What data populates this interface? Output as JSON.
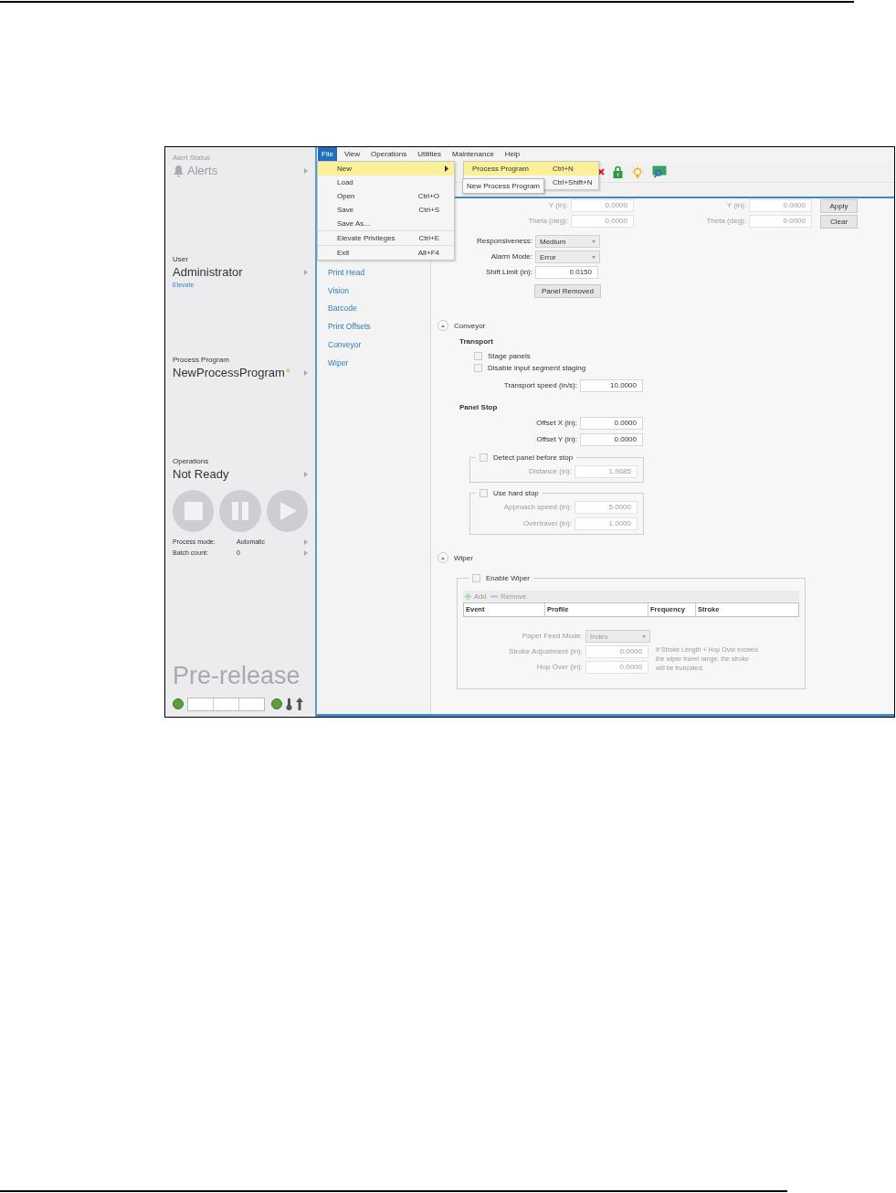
{
  "sidebar": {
    "alert_status": {
      "label": "Alert Status",
      "value": "Alerts",
      "disabled": true
    },
    "user": {
      "label": "User",
      "value": "Administrator",
      "link": "Elevate"
    },
    "process_program": {
      "label": "Process Program",
      "value": "NewProcessProgram",
      "modified_mark": "*"
    },
    "operations": {
      "label": "Operations",
      "value": "Not Ready",
      "controls": [
        {
          "kind": "stop"
        },
        {
          "kind": "pause"
        },
        {
          "kind": "play"
        }
      ],
      "details": [
        {
          "label": "Process mode:",
          "value": "Automatic"
        },
        {
          "label": "Batch count:",
          "value": "0"
        }
      ]
    },
    "badge": "Pre-release"
  },
  "menu_bar": [
    {
      "label": "File",
      "selected": true
    },
    {
      "label": "View",
      "selected": false
    },
    {
      "label": "Operations",
      "selected": false
    },
    {
      "label": "Utilities",
      "selected": false
    },
    {
      "label": "Maintenance",
      "selected": false
    },
    {
      "label": "Help",
      "selected": false
    }
  ],
  "file_menu": {
    "items": [
      {
        "label": "New",
        "submenu": true,
        "selected": true,
        "separator_before": false
      },
      {
        "label": "Load",
        "submenu": false,
        "selected": false,
        "separator_before": false
      },
      {
        "label": "Open",
        "shortcut": "Ctrl+O",
        "submenu": false,
        "selected": false,
        "separator_before": false
      },
      {
        "label": "Save",
        "shortcut": "Ctrl+S",
        "submenu": false,
        "selected": false,
        "separator_before": false
      },
      {
        "label": "Save As...",
        "submenu": false,
        "selected": false,
        "separator_before": false
      },
      {
        "label": "Elevate Privileges",
        "shortcut": "Ctrl+E",
        "submenu": false,
        "selected": false,
        "separator_before": true
      },
      {
        "label": "Exit",
        "shortcut": "Alt+F4",
        "submenu": false,
        "selected": false,
        "separator_before": true
      }
    ],
    "submenu": [
      {
        "label": "Process Program",
        "shortcut": "Ctrl+N",
        "selected": true
      },
      {
        "shortcut": "Ctrl+Shift+N",
        "selected": false
      }
    ],
    "tooltip": "New Process Program"
  },
  "toolbar": [
    {
      "kind": "close"
    },
    {
      "kind": "lock"
    },
    {
      "kind": "bulb"
    },
    {
      "kind": "monitor"
    }
  ],
  "nav": [
    "Print Head",
    "Vision",
    "Barcode",
    "Print Offsets",
    "Conveyor",
    "Wiper"
  ],
  "alignment": {
    "disabled": true,
    "rows": [
      {
        "label": "Y (in):",
        "value": "0.0000",
        "label_2": "Y (in):",
        "value_2": "0.0000",
        "button": "Apply"
      },
      {
        "label": "Theta (deg):",
        "value": "0.0000",
        "label_2": "Theta (deg):",
        "value_2": "0.0000",
        "button": "Clear"
      }
    ]
  },
  "settings": [
    {
      "label": "Responsiveness:",
      "kind": "dropdown",
      "value": "Medium"
    },
    {
      "label": "Alarm Mode:",
      "kind": "dropdown",
      "value": "Error"
    },
    {
      "label": "Shift Limit (in):",
      "kind": "number",
      "value": "0.0150"
    }
  ],
  "panel_removed_button": "Panel Removed",
  "conveyor": {
    "title": "Conveyor",
    "expanded": true,
    "transport": {
      "title": "Transport",
      "options": [
        {
          "label": "Stage panels",
          "checked": false
        },
        {
          "label": "Disable input segment staging",
          "checked": false
        }
      ],
      "speed": {
        "label": "Transport speed (in/s):",
        "value": "10.0000"
      }
    },
    "panel_stop": {
      "title": "Panel Stop",
      "offsets": [
        {
          "label": "Offset X (in):",
          "value": "0.0000"
        },
        {
          "label": "Offset Y (in):",
          "value": "0.0000"
        }
      ],
      "groups": [
        {
          "label": "Detect panel before stop",
          "checked": false,
          "fields": [
            {
              "label": "Distance (in):",
              "value": "1.9685"
            }
          ]
        },
        {
          "label": "Use hard stop",
          "checked": false,
          "fields": [
            {
              "label": "Approach speed (in):",
              "value": "5.0000"
            },
            {
              "label": "Overtravel (in):",
              "value": "1.0000"
            }
          ]
        }
      ]
    }
  },
  "wiper": {
    "title": "Wiper",
    "expanded": true,
    "enable": {
      "label": "Enable Wiper",
      "checked": false
    },
    "actions": [
      {
        "kind": "add",
        "label": "Add"
      },
      {
        "kind": "remove",
        "label": "Remove"
      }
    ],
    "columns": [
      "Event",
      "Profile",
      "Frequency",
      "Stroke"
    ],
    "fields": [
      {
        "label": "Paper Feed Mode:",
        "kind": "dropdown",
        "value": "Index"
      },
      {
        "label": "Stroke Adjustment (in):",
        "kind": "number",
        "value": "0.0000"
      },
      {
        "label": "Hop Over (in):",
        "kind": "number",
        "value": "0.0000"
      }
    ],
    "note": "If Stroke Length + Hop Over exceed the wiper travel range, the stroke will be truncated."
  }
}
